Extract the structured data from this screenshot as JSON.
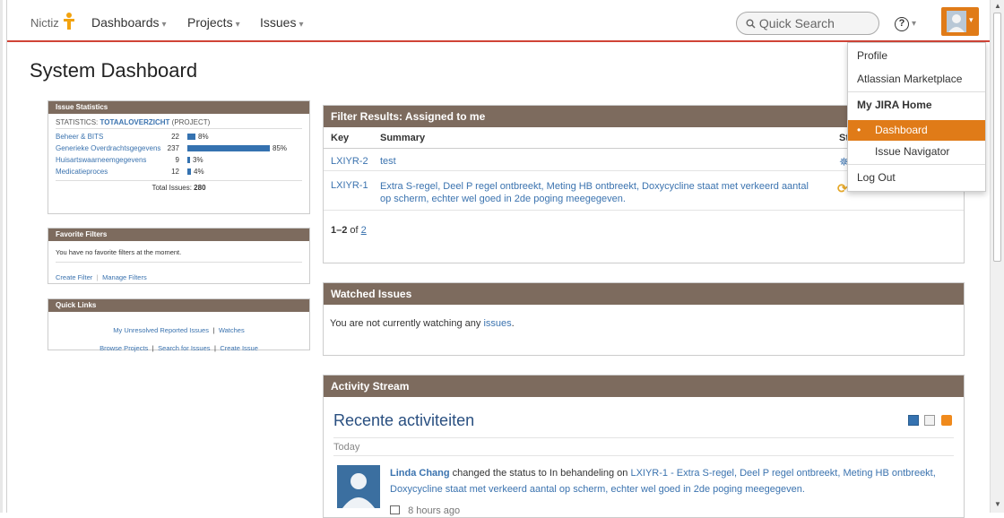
{
  "header": {
    "brand": "Nictiz",
    "nav": [
      "Dashboards",
      "Projects",
      "Issues"
    ],
    "search_placeholder": "Quick Search",
    "help_glyph": "?"
  },
  "page": {
    "title": "System Dashboard"
  },
  "issue_statistics": {
    "header": "Issue Statistics",
    "label_prefix": "STATISTICS:",
    "label_link": "TOTAALOVERZICHT",
    "label_suffix": "(PROJECT)",
    "rows": [
      {
        "name": "Beheer & BITS",
        "count": "22",
        "percent": "8%",
        "fraction": 0.08
      },
      {
        "name": "Generieke Overdrachtsgegevens",
        "count": "237",
        "percent": "85%",
        "fraction": 0.85
      },
      {
        "name": "Huisartswaarneemgegevens",
        "count": "9",
        "percent": "3%",
        "fraction": 0.03
      },
      {
        "name": "Medicatieproces",
        "count": "12",
        "percent": "4%",
        "fraction": 0.04
      }
    ],
    "total_label": "Total Issues:",
    "total_value": "280"
  },
  "favorite_filters": {
    "header": "Favorite Filters",
    "message": "You have no favorite filters at the moment.",
    "create": "Create Filter",
    "manage": "Manage Filters",
    "divider": "|"
  },
  "quick_links": {
    "header": "Quick Links",
    "line1": [
      "My Unresolved Reported Issues",
      "Watches"
    ],
    "line2": [
      "Browse Projects",
      "Search for Issues",
      "Create Issue"
    ],
    "divider": "|"
  },
  "filter_results": {
    "header": "Filter Results: Assigned to me",
    "col_key": "Key",
    "col_summary": "Summary",
    "col_status": "St",
    "rows": [
      {
        "key": "LXIYR-2",
        "summary_1": "test",
        "summary_2": ""
      },
      {
        "key": "LXIYR-1",
        "summary_1": "Extra S-regel, Deel P regel ontbreekt, Meting HB ontbreekt, Doxycycline staat met verkeerd aantal",
        "summary_2": "op scherm, echter wel goed in 2de poging meegegeven."
      }
    ],
    "pager_range": "1–2",
    "pager_of": "of",
    "pager_total": "2"
  },
  "watched": {
    "header": "Watched Issues",
    "text_prefix": "You are not currently watching any",
    "link": "issues",
    "text_suffix": "."
  },
  "activity": {
    "header": "Activity Stream",
    "title": "Recente activiteiten",
    "day": "Today",
    "user": "Linda Chang",
    "action": "changed the status to In behandeling on",
    "issue_1": "LXIYR-1 - Extra S-regel, Deel P regel ontbreekt, Meting HB ontbreekt,",
    "issue_2": "Doxycycline staat met verkeerd aantal op scherm, echter wel goed in 2de poging meegegeven.",
    "time": "8 hours ago"
  },
  "user_menu": {
    "items": [
      "Profile",
      "Atlassian Marketplace"
    ],
    "section": "My JIRA Home",
    "home_items": [
      "Dashboard",
      "Issue Navigator"
    ],
    "logout": "Log Out",
    "bullet": "•"
  },
  "colors": {
    "accent": "#e07b18",
    "gadget_header": "#7d6b5e",
    "link": "#3b73af",
    "bar": "#3572b0"
  }
}
